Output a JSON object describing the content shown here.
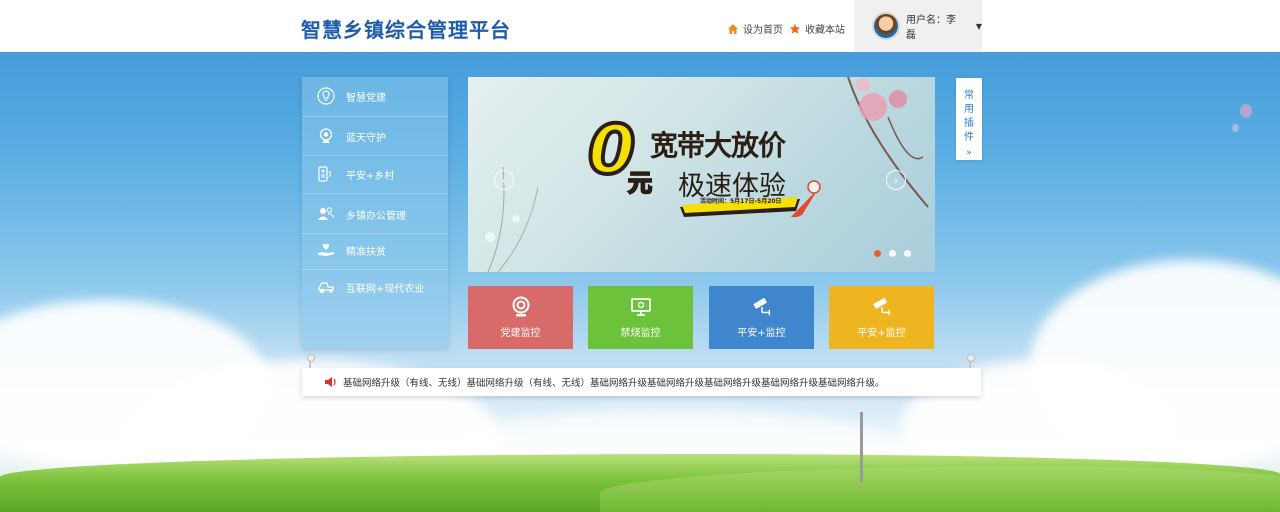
{
  "header": {
    "site_title": "智慧乡镇综合管理平台",
    "set_home_label": "设为首页",
    "bookmark_label": "收藏本站",
    "user_label": "用户名：李磊"
  },
  "sidebar": {
    "items": [
      {
        "label": "智慧党建",
        "icon": "lightbulb-icon"
      },
      {
        "label": "蓝天守护",
        "icon": "webcam-icon"
      },
      {
        "label": "平安+乡村",
        "icon": "intercom-icon"
      },
      {
        "label": "乡镇办公管理",
        "icon": "people-icon"
      },
      {
        "label": "精准扶贫",
        "icon": "heart-hand-icon"
      },
      {
        "label": "互联网+现代农业",
        "icon": "tractor-icon"
      }
    ]
  },
  "banner": {
    "headline_top": "宽带大放价",
    "headline_zero": "0",
    "headline_yuan": "元",
    "headline_bottom": "极速体验",
    "event_time": "活动时间：5月17日-5月20日",
    "slide_count": 3,
    "active_slide": 1
  },
  "plugin_tab": {
    "chars": [
      "常",
      "用",
      "插",
      "件"
    ]
  },
  "tiles": [
    {
      "label": "党建监控",
      "color": "#d96a6a",
      "icon": "webcam-icon"
    },
    {
      "label": "禁烧监控",
      "color": "#6cc23a",
      "icon": "monitor-icon"
    },
    {
      "label": "平安+监控",
      "color": "#3f86cf",
      "icon": "cctv-camera-icon"
    },
    {
      "label": "平安+监控",
      "color": "#efb520",
      "icon": "cctv-camera-icon"
    }
  ],
  "notice": {
    "text": "基础网络升级（有线、无线）基础网络升级（有线、无线）基础网络升级基础网络升级基础网络升级基础网络升级基础网络升级。"
  },
  "colors": {
    "brand_blue": "#1f5cab",
    "home_icon": "#f08a1c",
    "star_icon": "#f06a1c",
    "active_dot": "#e8622b"
  }
}
